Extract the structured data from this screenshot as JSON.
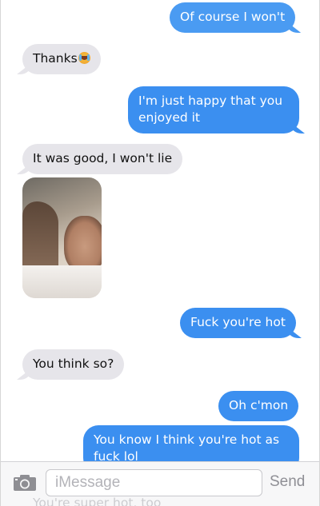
{
  "messages": [
    {
      "id": "m1",
      "from": "me",
      "text": "Of course I won't"
    },
    {
      "id": "m2",
      "from": "them",
      "text": "Thanks",
      "emoji": "crying-laughing-emoji"
    },
    {
      "id": "m3",
      "from": "me",
      "lines": [
        "I'm just happy that you",
        "enjoyed it"
      ]
    },
    {
      "id": "m4",
      "from": "them",
      "text": "It was good, I won't lie"
    },
    {
      "id": "m5",
      "from": "them",
      "type": "photo"
    },
    {
      "id": "m6",
      "from": "me",
      "text": "Fuck you're hot"
    },
    {
      "id": "m7",
      "from": "them",
      "text": "You think so?"
    },
    {
      "id": "m8",
      "from": "me",
      "text": "Oh c'mon"
    },
    {
      "id": "m9",
      "from": "me",
      "lines": [
        "You know I think you're hot as",
        "fuck lol"
      ]
    },
    {
      "id": "m10",
      "from": "them",
      "text": "You're super hot, too"
    }
  ],
  "composer": {
    "placeholder": "iMessage",
    "send_label": "Send",
    "camera_icon": "camera-icon"
  },
  "colors": {
    "sent": "#3b8ff0",
    "received": "#e6e5ea",
    "send_disabled": "#8f8f95"
  }
}
